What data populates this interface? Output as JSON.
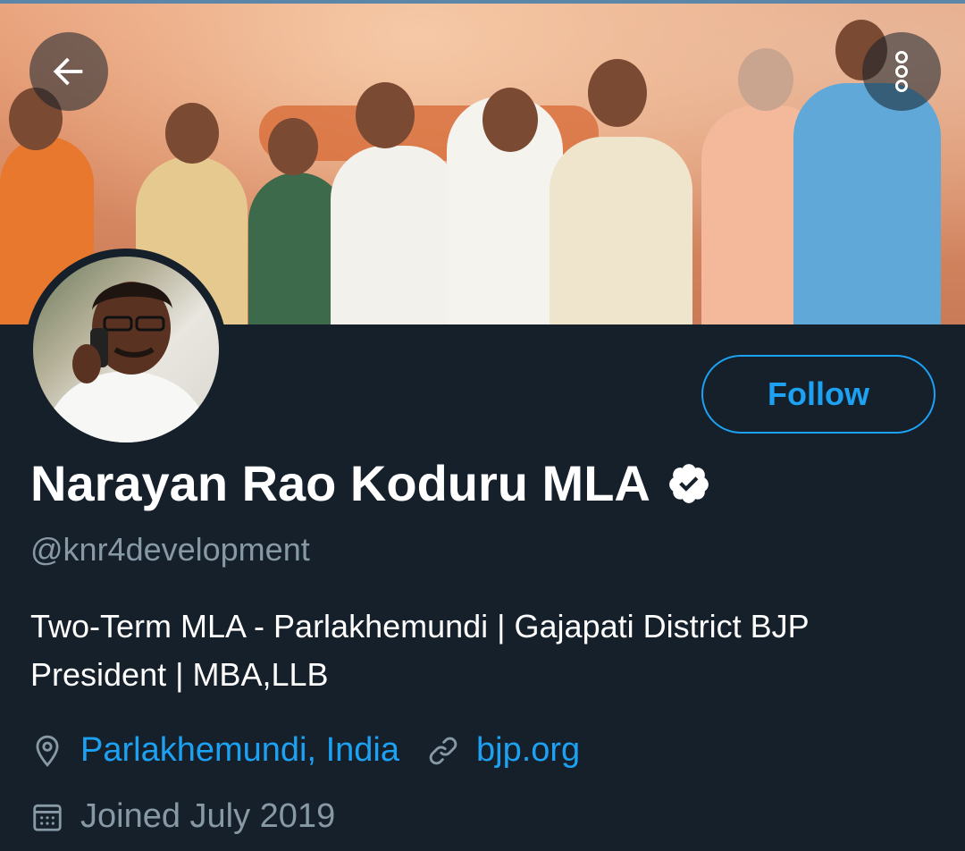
{
  "header": {
    "back_icon": "arrow-left-icon",
    "more_icon": "more-vertical-icon",
    "banner_image": "rally-stage-photo"
  },
  "profile": {
    "avatar_image": "profile-photo-man-on-phone",
    "display_name": "Narayan Rao Koduru MLA",
    "verified_icon": "verified-badge-icon",
    "handle": "@knr4development",
    "bio": "Two-Term MLA - Parlakhemundi | Gajapati District BJP President | MBA,LLB",
    "location": "Parlakhemundi, India",
    "location_icon": "location-pin-icon",
    "website": "bjp.org",
    "website_icon": "link-icon",
    "joined": "Joined July 2019",
    "joined_icon": "calendar-icon"
  },
  "actions": {
    "follow_label": "Follow"
  },
  "colors": {
    "background": "#15202b",
    "accent": "#1da1f2",
    "muted_text": "#8899a6",
    "primary_text": "#ffffff"
  }
}
